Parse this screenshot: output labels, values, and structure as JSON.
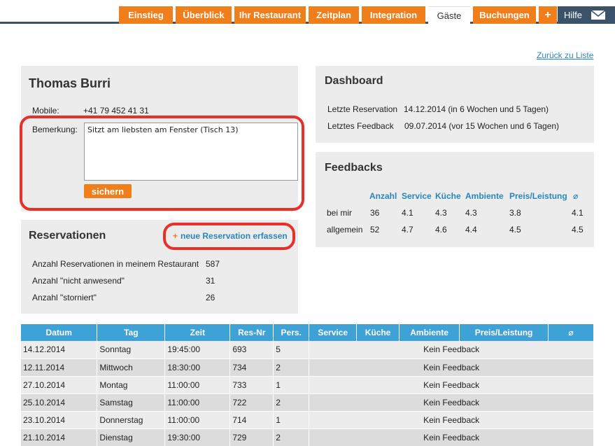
{
  "nav": {
    "tabs": [
      {
        "label": "Einstieg",
        "active": false
      },
      {
        "label": "Überblick",
        "active": false
      },
      {
        "label": "Ihr Restaurant",
        "active": false
      },
      {
        "label": "Zeitplan",
        "active": false
      },
      {
        "label": "Integration",
        "active": false
      },
      {
        "label": "Gäste",
        "active": true
      },
      {
        "label": "Buchungen",
        "active": false
      },
      {
        "label": "+",
        "active": false
      }
    ],
    "help": "Hilfe",
    "mail_icon": "envelope-icon"
  },
  "back_link": "Zurück zu Liste",
  "guest": {
    "name": "Thomas Burri",
    "mobile_label": "Mobile:",
    "mobile_value": "+41 79 452 41 31",
    "note_label": "Bemerkung:",
    "note_value": "Sitzt am liebsten am Fenster (Tisch 13)",
    "save_label": "sichern"
  },
  "reservations": {
    "title": "Reservationen",
    "new_label": "neue Reservation erfassen",
    "stats": [
      {
        "label": "Anzahl Reservationen in meinem Restaurant",
        "value": "587"
      },
      {
        "label": "Anzahl \"nicht anwesend\"",
        "value": "31"
      },
      {
        "label": "Anzahl \"storniert\"",
        "value": "26"
      }
    ]
  },
  "dashboard": {
    "title": "Dashboard",
    "rows": [
      {
        "label": "Letzte Reservation",
        "value": "14.12.2014 (in 6 Wochen und 5 Tagen)"
      },
      {
        "label": "Letztes Feedback",
        "value": "09.07.2014 (vor 15 Wochen und 6 Tagen)"
      }
    ]
  },
  "feedbacks": {
    "title": "Feedbacks",
    "headers": [
      "Anzahl",
      "Service",
      "Küche",
      "Ambiente",
      "Preis/Leistung",
      "⌀"
    ],
    "rows": [
      {
        "label": "bei mir",
        "values": [
          "36",
          "4.1",
          "4.3",
          "4.3",
          "3.8",
          "4.1"
        ]
      },
      {
        "label": "allgemein",
        "values": [
          "52",
          "4.7",
          "4.6",
          "4.4",
          "4.5",
          "4.5"
        ]
      }
    ]
  },
  "table": {
    "headers": [
      "Datum",
      "Tag",
      "Zeit",
      "Res-Nr",
      "Pers.",
      "Service",
      "Küche",
      "Ambiente",
      "Preis/Leistung",
      "⌀"
    ],
    "rows": [
      {
        "datum": "14.12.2014",
        "tag": "Sonntag",
        "zeit": "19:45:00",
        "resnr": "693",
        "pers": "5",
        "feedback": "Kein Feedback"
      },
      {
        "datum": "12.11.2014",
        "tag": "Mittwoch",
        "zeit": "18:30:00",
        "resnr": "734",
        "pers": "2",
        "feedback": "Kein Feedback"
      },
      {
        "datum": "27.10.2014",
        "tag": "Montag",
        "zeit": "11:00:00",
        "resnr": "733",
        "pers": "1",
        "feedback": "Kein Feedback"
      },
      {
        "datum": "25.10.2014",
        "tag": "Samstag",
        "zeit": "11:00:00",
        "resnr": "722",
        "pers": "2",
        "feedback": "Kein Feedback"
      },
      {
        "datum": "23.10.2014",
        "tag": "Donnerstag",
        "zeit": "11:00:00",
        "resnr": "714",
        "pers": "1",
        "feedback": "Kein Feedback"
      },
      {
        "datum": "21.10.2014",
        "tag": "Dienstag",
        "zeit": "19:30:00",
        "resnr": "729",
        "pers": "2",
        "feedback": "Kein Feedback"
      }
    ]
  },
  "colors": {
    "accent": "#f07f1b",
    "navy": "#3a536b",
    "table_header": "#3fa2d6",
    "highlight": "#e8302a",
    "link": "#2a86b8"
  }
}
